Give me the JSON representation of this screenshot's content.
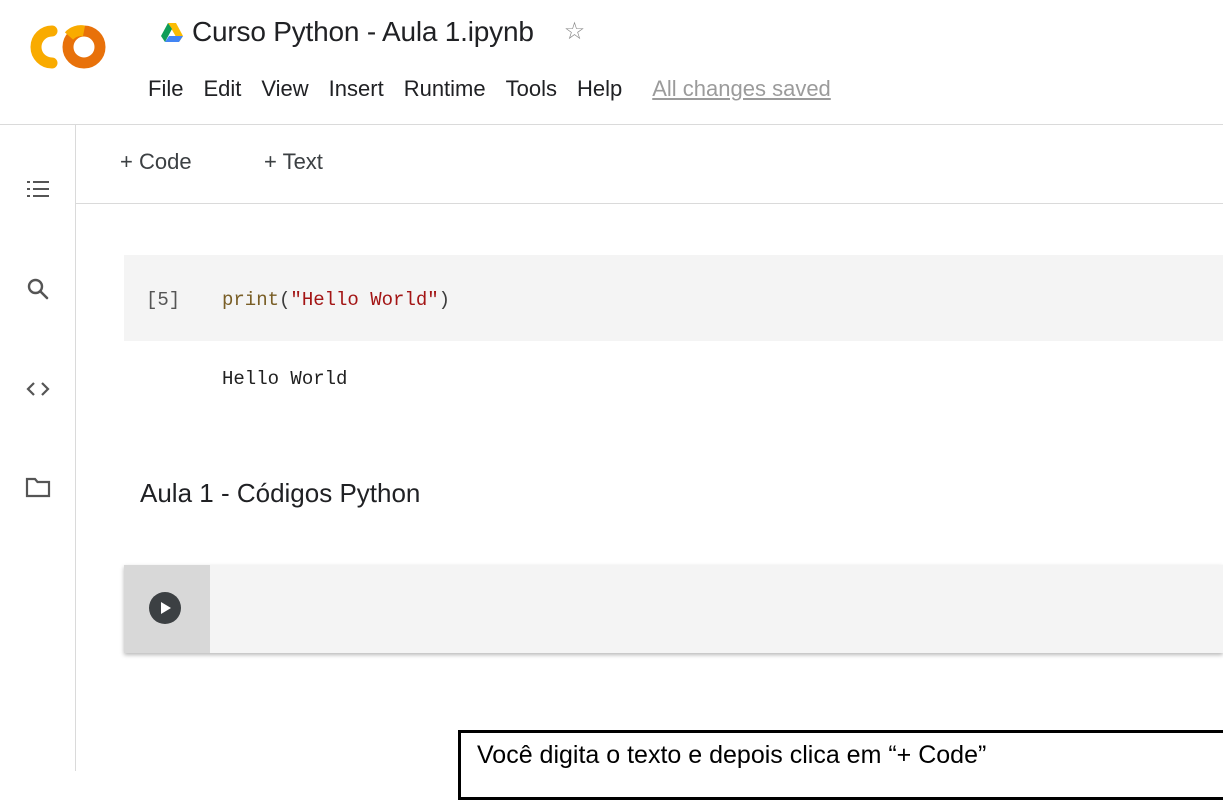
{
  "header": {
    "title": "Curso Python - Aula 1.ipynb",
    "menu": [
      "File",
      "Edit",
      "View",
      "Insert",
      "Runtime",
      "Tools",
      "Help"
    ],
    "save_status": "All changes saved"
  },
  "toolbar": {
    "add_code": "+ Code",
    "add_text": "+ Text"
  },
  "sidebar": {
    "icons": [
      "table-of-contents-icon",
      "search-icon",
      "code-snippets-icon",
      "files-icon"
    ]
  },
  "cells": {
    "code": {
      "execution_count": "[5]",
      "fn": "print",
      "open": "(",
      "string": "\"Hello World\"",
      "close": ")",
      "output": "Hello World"
    },
    "markdown": {
      "text": "Aula 1 - Códigos Python"
    }
  },
  "callout": {
    "text": "Você digita o texto e depois clica em “+ Code”"
  },
  "colors": {
    "logo_orange": "#F9AB00",
    "logo_dark_orange": "#E8710A",
    "string": "#A31515",
    "function": "#795E26"
  }
}
